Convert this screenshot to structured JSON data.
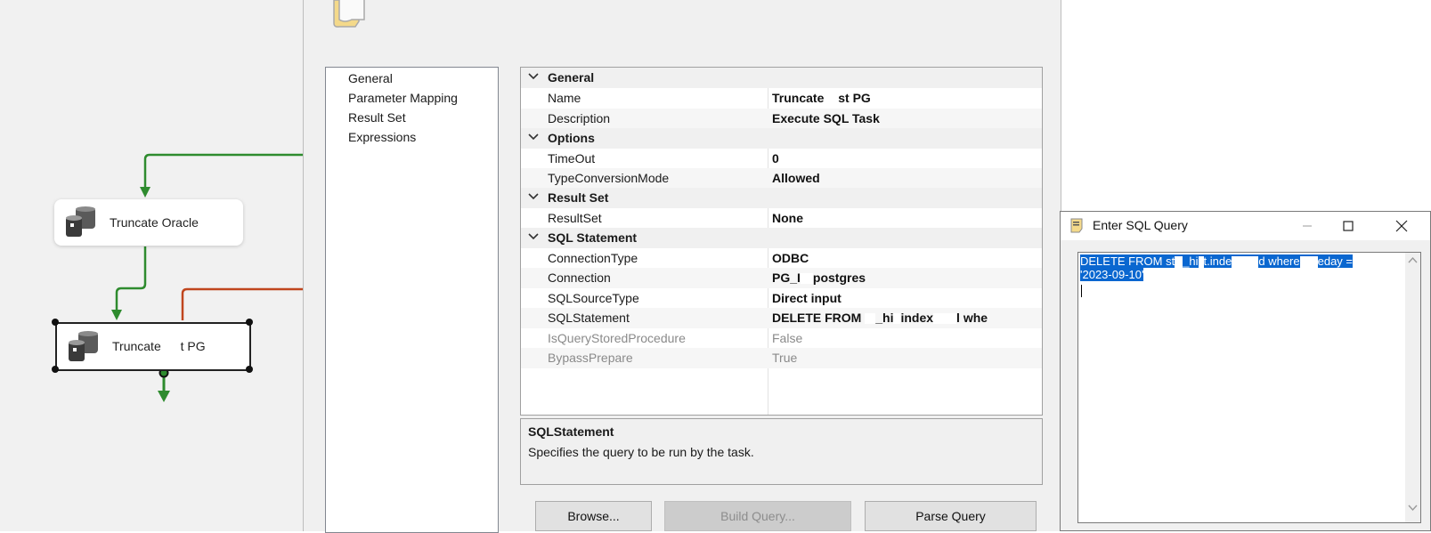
{
  "canvas": {
    "tasks": [
      {
        "label": "Truncate Oracle"
      },
      {
        "label": "Truncate ",
        "label_tail": "t PG"
      }
    ]
  },
  "dialog": {
    "nav": [
      "General",
      "Parameter Mapping",
      "Result Set",
      "Expressions"
    ],
    "categories": {
      "general": "General",
      "options": "Options",
      "result_set": "Result Set",
      "sql_statement": "SQL Statement"
    },
    "properties": {
      "name": {
        "label": "Name",
        "value": "Truncate ",
        "value_tail": "st PG"
      },
      "description": {
        "label": "Description",
        "value": "Execute SQL Task"
      },
      "timeout": {
        "label": "TimeOut",
        "value": "0"
      },
      "type_conversion": {
        "label": "TypeConversionMode",
        "value": "Allowed"
      },
      "result_set": {
        "label": "ResultSet",
        "value": "None"
      },
      "connection_type": {
        "label": "ConnectionType",
        "value": "ODBC"
      },
      "connection": {
        "label": "Connection",
        "value": "PG_I",
        "value_tail": "postgres"
      },
      "sql_source_type": {
        "label": "SQLSourceType",
        "value": "Direct input"
      },
      "sql_statement": {
        "label": "SQLStatement",
        "value": "DELETE FROM ",
        "value_mid": "_hi",
        "value_mid2": "index",
        "value_tail": "l whe"
      },
      "is_query_stored_procedure": {
        "label": "IsQueryStoredProcedure",
        "value": "False"
      },
      "bypass_prepare": {
        "label": "BypassPrepare",
        "value": "True"
      }
    },
    "description": {
      "title": "SQLStatement",
      "text": "Specifies the query to be run by the task."
    },
    "buttons": {
      "browse": "Browse...",
      "build_query": "Build Query...",
      "parse_query": "Parse Query"
    }
  },
  "sql_window": {
    "title": "Enter SQL Query",
    "query_line1": "DELETE FROM st",
    "query_line1b": "_hi",
    "query_line1c": "t.inde",
    "query_line1d": "d where",
    "query_line1e": "eday =",
    "query_line2": "'2023-09-10'"
  },
  "colors": {
    "success_arrow": "#2e8b2e",
    "failure_arrow": "#c0461e",
    "selection": "#0a67d0"
  }
}
